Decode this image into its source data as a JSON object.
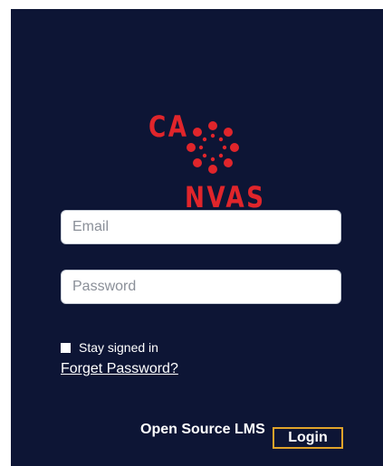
{
  "brand": {
    "logo_text_top": "CA",
    "logo_text_bottom": "NVAS",
    "logo_icon": "canvas-logo-icon",
    "accent_color": "#e0252b"
  },
  "form": {
    "email_placeholder": "Email",
    "email_value": "",
    "password_placeholder": "Password",
    "password_value": "",
    "stay_signed_in_label": "Stay signed in",
    "stay_signed_in_checked": false,
    "forget_password_label": "Forget Password?"
  },
  "footer": {
    "label": "Open Source LMS",
    "login_button": "Login"
  },
  "colors": {
    "panel_background": "#0d1535",
    "button_border": "#e0a32a"
  }
}
